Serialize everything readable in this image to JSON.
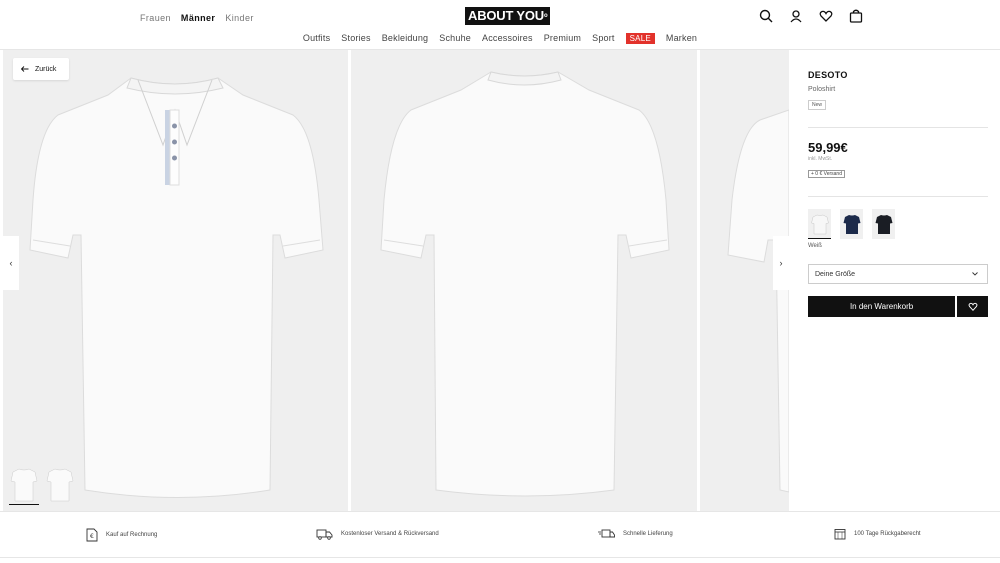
{
  "header": {
    "gender_tabs": [
      "Frauen",
      "Männer",
      "Kinder"
    ],
    "logo": "ABOUT YOU",
    "nav": [
      "Outfits",
      "Stories",
      "Bekleidung",
      "Schuhe",
      "Accessoires",
      "Premium",
      "Sport",
      "SALE",
      "Marken"
    ],
    "icons": [
      "search-icon",
      "user-icon",
      "heart-icon",
      "bag-icon"
    ]
  },
  "gallery": {
    "back_label": "Zurück",
    "images": [
      "polo-front",
      "polo-back",
      "polo-side"
    ]
  },
  "product": {
    "brand": "DESOTO",
    "type": "Poloshirt",
    "badge": "New",
    "price": "59,99€",
    "price_note": "inkl. MwSt.",
    "shipping": "+ 0 € Versand",
    "color_name": "Weiß",
    "swatch_colors": [
      "#f2f2f2",
      "#1c2a4a",
      "#1a1d24"
    ],
    "size_placeholder": "Deine Größe",
    "cart_label": "In den Warenkorb"
  },
  "usp": {
    "items": [
      "Kauf auf Rechnung",
      "Kostenloser Versand & Rückversand",
      "Schnelle Lieferung",
      "100 Tage Rückgaberecht"
    ]
  },
  "colors": {
    "accent": "#e2322b",
    "primary": "#111111",
    "panel": "#efefef"
  }
}
